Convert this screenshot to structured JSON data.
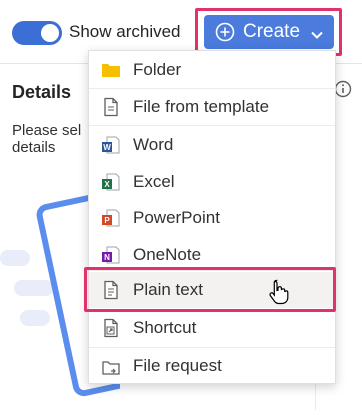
{
  "topbar": {
    "show_archived_label": "Show archived",
    "show_archived_on": true,
    "create_label": "Create",
    "accent_color": "#4a7bdd",
    "highlight_color": "#e0336b"
  },
  "details": {
    "title": "Details",
    "text_line1": "Please sel",
    "text_line2": "details"
  },
  "menu": {
    "items": [
      {
        "label": "Folder",
        "icon": "folder-icon"
      },
      {
        "label": "File from template",
        "icon": "file-template-icon"
      },
      {
        "label": "Word",
        "icon": "word-icon"
      },
      {
        "label": "Excel",
        "icon": "excel-icon"
      },
      {
        "label": "PowerPoint",
        "icon": "powerpoint-icon"
      },
      {
        "label": "OneNote",
        "icon": "onenote-icon"
      },
      {
        "label": "Plain text",
        "icon": "text-file-icon"
      },
      {
        "label": "Shortcut",
        "icon": "shortcut-icon"
      },
      {
        "label": "File request",
        "icon": "file-request-icon"
      }
    ],
    "hovered_item": "Plain text"
  }
}
